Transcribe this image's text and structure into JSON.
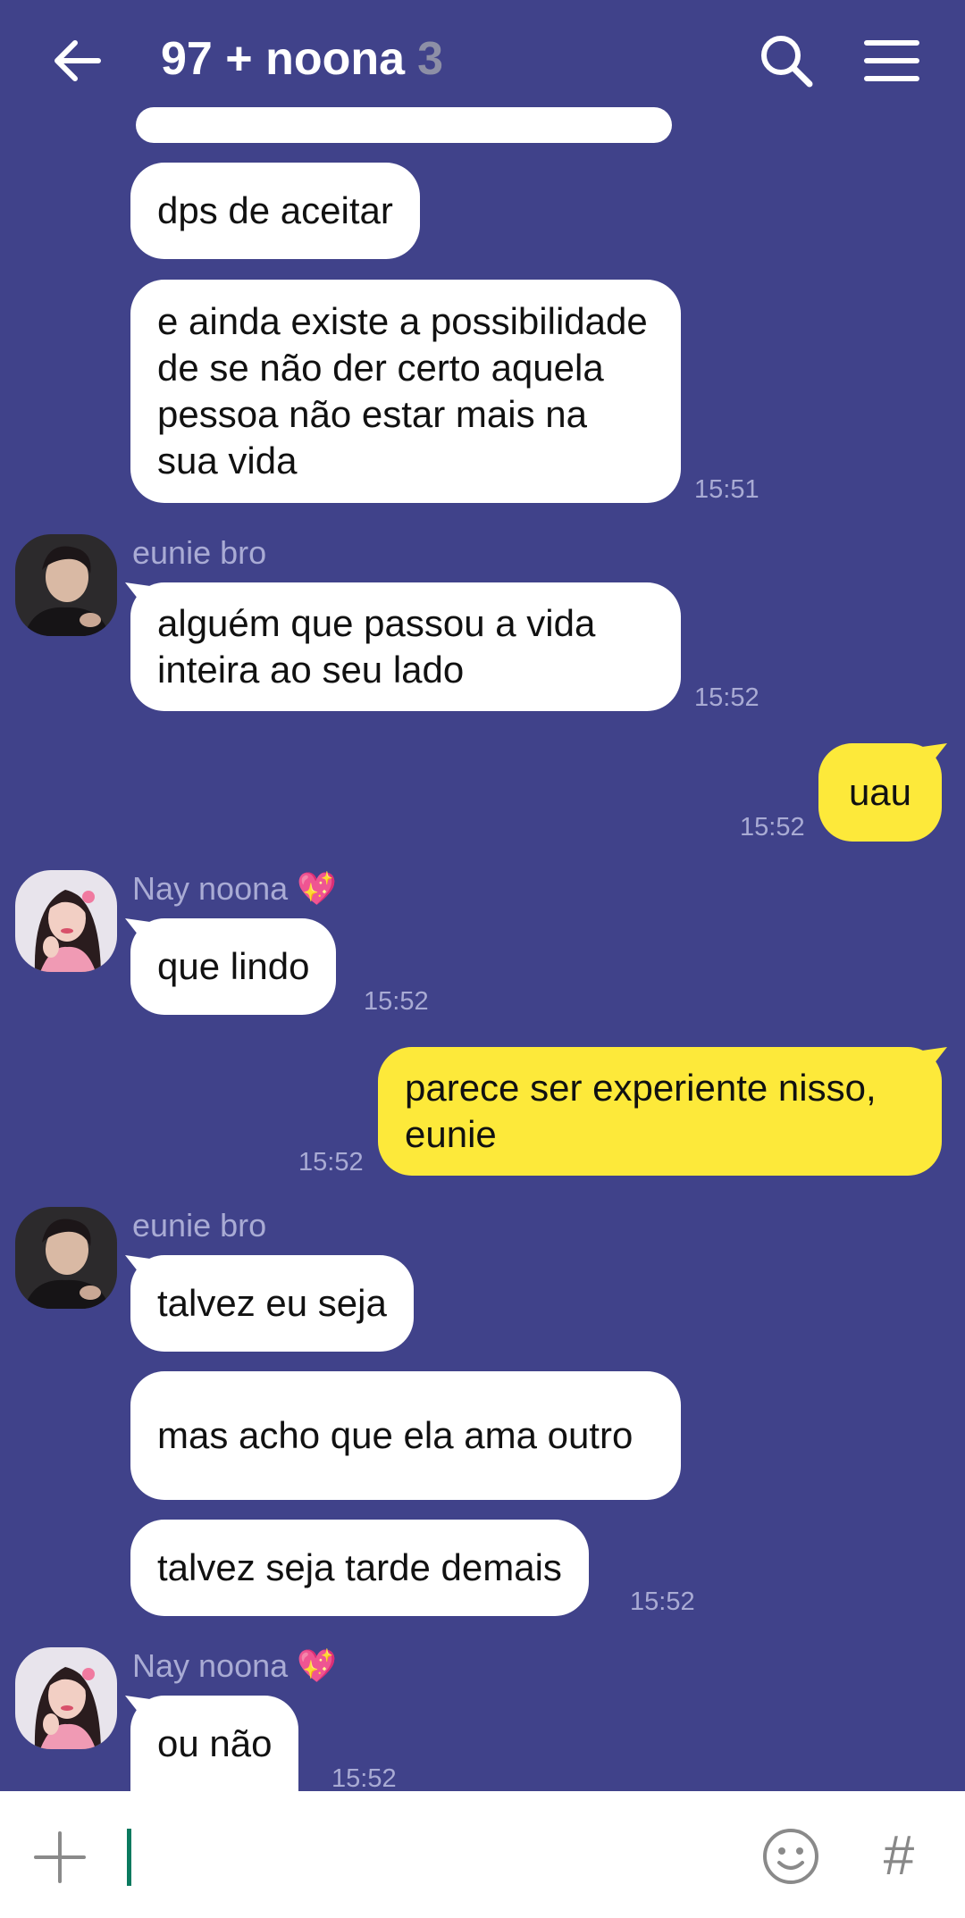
{
  "header": {
    "title": "97 + noona",
    "member_count": "3",
    "back_icon": "arrow-left-icon",
    "search_icon": "search-icon",
    "menu_icon": "menu-icon"
  },
  "messages": [
    {
      "text": "dps de aceitar"
    },
    {
      "text": "e ainda existe a possibilidade de se não der certo aquela pessoa não estar mais na sua vida",
      "time": "15:51"
    },
    {
      "sender": "eunie bro",
      "text": "alguém que passou a vida inteira ao seu lado",
      "time": "15:52"
    },
    {
      "text": "uau",
      "time": "15:52"
    },
    {
      "sender": "Nay noona 💖",
      "text": "que lindo",
      "time": "15:52"
    },
    {
      "text": "parece ser experiente nisso, eunie",
      "time": "15:52"
    },
    {
      "sender": "eunie bro",
      "text": "talvez eu seja"
    },
    {
      "text": "mas acho que ela ama outro"
    },
    {
      "text": "talvez seja tarde demais",
      "time": "15:52"
    },
    {
      "sender": "Nay noona 💖",
      "text": "ou não",
      "time": "15:52"
    }
  ],
  "input": {
    "plus_icon": "plus-icon",
    "emoji_icon": "emoji-icon",
    "hash_label": "#"
  },
  "colors": {
    "background": "#40428a",
    "incoming_bubble": "#ffffff",
    "outgoing_bubble": "#fde93a",
    "meta_text": "#a9abd4"
  }
}
